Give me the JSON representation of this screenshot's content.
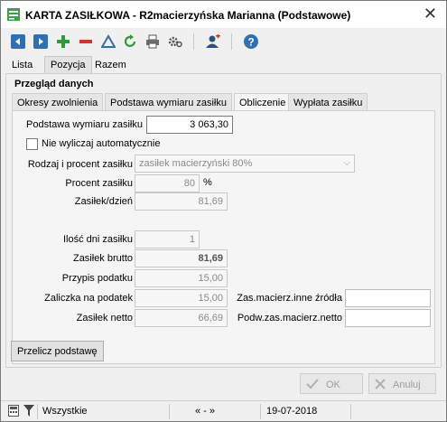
{
  "window": {
    "title": "KARTA ZASIŁKOWA - R2macierzyńska Marianna (Podstawowe)",
    "close_glyph": "✕"
  },
  "toolbar": {
    "icons": [
      "arrow-left-icon",
      "arrow-right-icon",
      "add-icon",
      "delete-icon",
      "warning-icon",
      "refresh-icon",
      "print-icon",
      "settings-icon",
      "user-add-icon",
      "help-icon"
    ]
  },
  "main_tabs": [
    "Lista",
    "Pozycja",
    "Razem"
  ],
  "section": {
    "title": "Przegląd danych"
  },
  "sub_tabs": [
    "Okresy zwolnienia",
    "Podstawa wymiaru zasiłku",
    "Obliczenie",
    "Wypłata zasiłku"
  ],
  "form": {
    "podstawa_label": "Podstawa wymiaru zasiłku",
    "podstawa_value": "3 063,30",
    "auto_checkbox_label": "Nie wyliczaj automatycznie",
    "rodzaj_label": "Rodzaj i procent zasiłku",
    "rodzaj_value": "zasiłek macierzyński 80%",
    "procent_label": "Procent zasiłku",
    "procent_value": "80",
    "procent_unit": "%",
    "zasilek_dzien_label": "Zasiłek/dzień",
    "zasilek_dzien_value": "81,69",
    "ilosc_dni_label": "Ilość dni zasiłku",
    "ilosc_dni_value": "1",
    "brutto_label": "Zasiłek brutto",
    "brutto_value": "81,69",
    "przypis_label": "Przypis podatku",
    "przypis_value": "15,00",
    "zaliczka_label": "Zaliczka na podatek",
    "zaliczka_value": "15,00",
    "netto_label": "Zasiłek netto",
    "netto_value": "66,69",
    "inne_zrodla_label": "Zas.macierz.inne źródła",
    "inne_zrodla_value": "",
    "podw_netto_label": "Podw.zas.macierz.netto",
    "podw_netto_value": ""
  },
  "buttons": {
    "przelicz": "Przelicz podstawę",
    "ok": "OK",
    "anuluj": "Anuluj"
  },
  "statusbar": {
    "filter": "Wszystkie",
    "nav": "« - »",
    "date": "19-07-2018"
  },
  "colors": {
    "accent_blue": "#2f6fb5",
    "green": "#2e9b3a",
    "red": "#d9312b"
  }
}
